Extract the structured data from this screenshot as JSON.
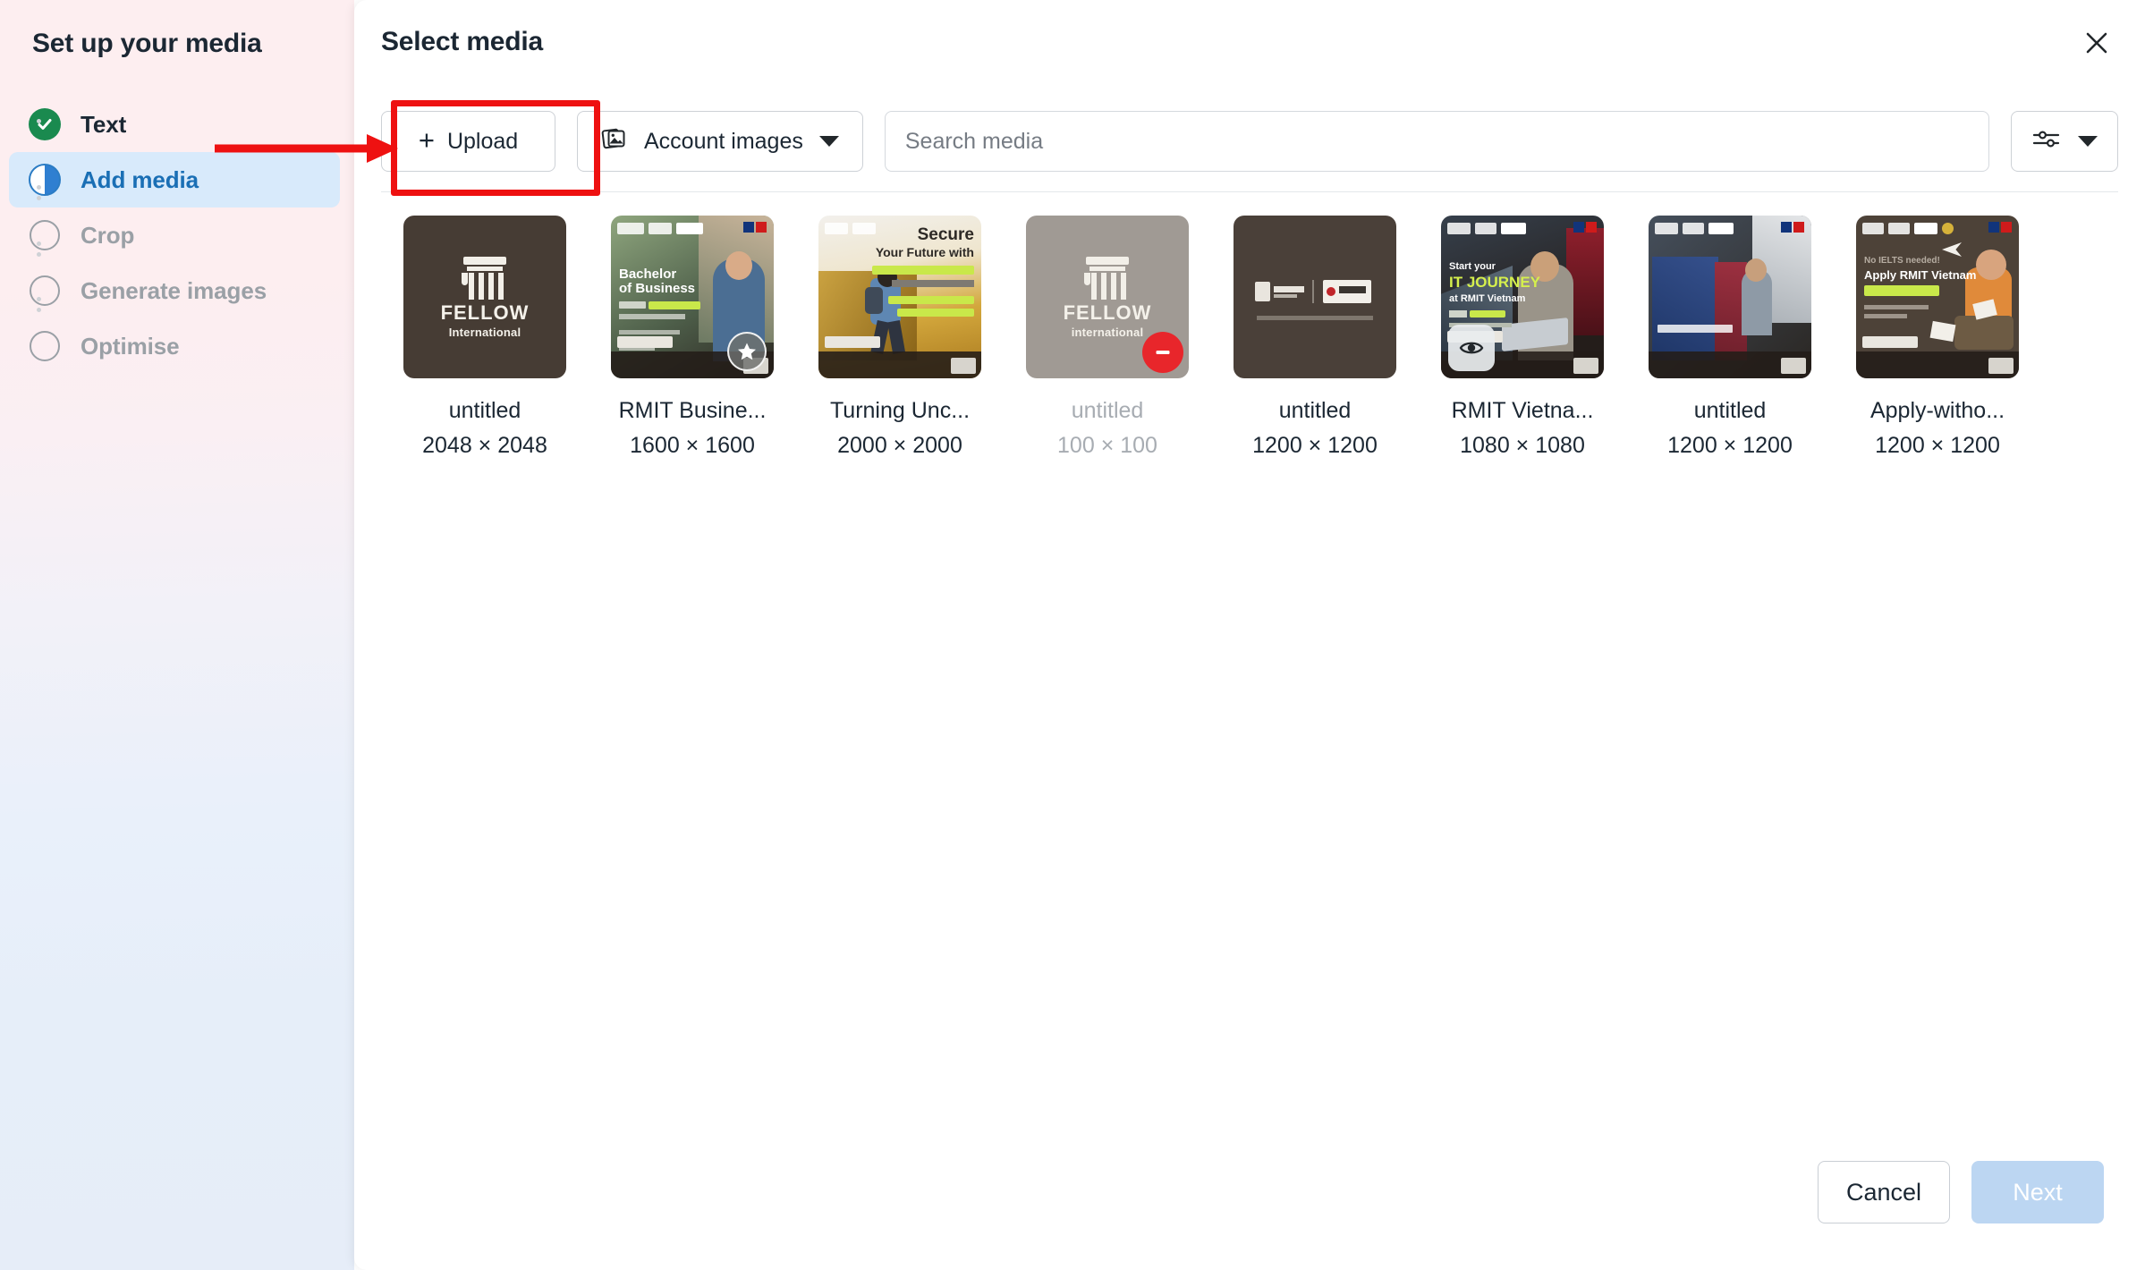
{
  "sidebar": {
    "title": "Set up your media",
    "steps": [
      {
        "label": "Text",
        "state": "done",
        "icon": "check-circle-icon"
      },
      {
        "label": "Add media",
        "state": "active",
        "icon": "half-circle-icon"
      },
      {
        "label": "Crop",
        "state": "pending",
        "icon": "empty-circle-icon"
      },
      {
        "label": "Generate images",
        "state": "pending",
        "icon": "empty-circle-icon"
      },
      {
        "label": "Optimise",
        "state": "pending",
        "icon": "empty-circle-icon"
      }
    ]
  },
  "dialog": {
    "title": "Select media",
    "close_label": "×"
  },
  "toolbar": {
    "upload_label": "Upload",
    "upload_icon": "plus-icon",
    "account_images_label": "Account images",
    "account_images_icon": "stacked-images-icon",
    "account_images_caret": "chevron-down-icon",
    "filter_icon": "sliders-icon",
    "filter_caret": "chevron-down-icon",
    "search_placeholder": "Search media",
    "search_value": ""
  },
  "media": {
    "items": [
      {
        "name": "untitled",
        "dimensions": "2048 × 2048",
        "badge": "none",
        "disabled": false,
        "kind": "logo-dark"
      },
      {
        "name": "RMIT Busine...",
        "dimensions": "1600 × 1600",
        "badge": "star",
        "disabled": false,
        "kind": "photo-bachelor"
      },
      {
        "name": "Turning Unc...",
        "dimensions": "2000 × 2000",
        "badge": "none",
        "disabled": false,
        "kind": "photo-secure"
      },
      {
        "name": "untitled",
        "dimensions": "100 × 100",
        "badge": "block",
        "disabled": true,
        "kind": "logo-gray"
      },
      {
        "name": "untitled",
        "dimensions": "1200 × 1200",
        "badge": "none",
        "disabled": false,
        "kind": "logo-duo"
      },
      {
        "name": "RMIT Vietna...",
        "dimensions": "1080 × 1080",
        "badge": "eye",
        "disabled": false,
        "kind": "photo-it"
      },
      {
        "name": "untitled",
        "dimensions": "1200 × 1200",
        "badge": "none",
        "disabled": false,
        "kind": "photo-campus"
      },
      {
        "name": "Apply-witho...",
        "dimensions": "1200 × 1200",
        "badge": "none",
        "disabled": false,
        "kind": "photo-ielts"
      }
    ],
    "badge_names": {
      "star": "favourite-star-icon",
      "block": "not-allowed-icon",
      "eye": "preview-eye-icon"
    }
  },
  "footer": {
    "cancel_label": "Cancel",
    "next_label": "Next",
    "next_disabled": true
  },
  "annotations": {
    "highlight_color": "#ee1111",
    "arrow_target": "upload-button"
  },
  "colors": {
    "accent_blue": "#1a6fb5",
    "step_done_green": "#1a8a4f",
    "active_row_bg": "#d8eafb",
    "next_disabled_bg": "#bcd6f2",
    "annotation_red": "#ee1111"
  }
}
